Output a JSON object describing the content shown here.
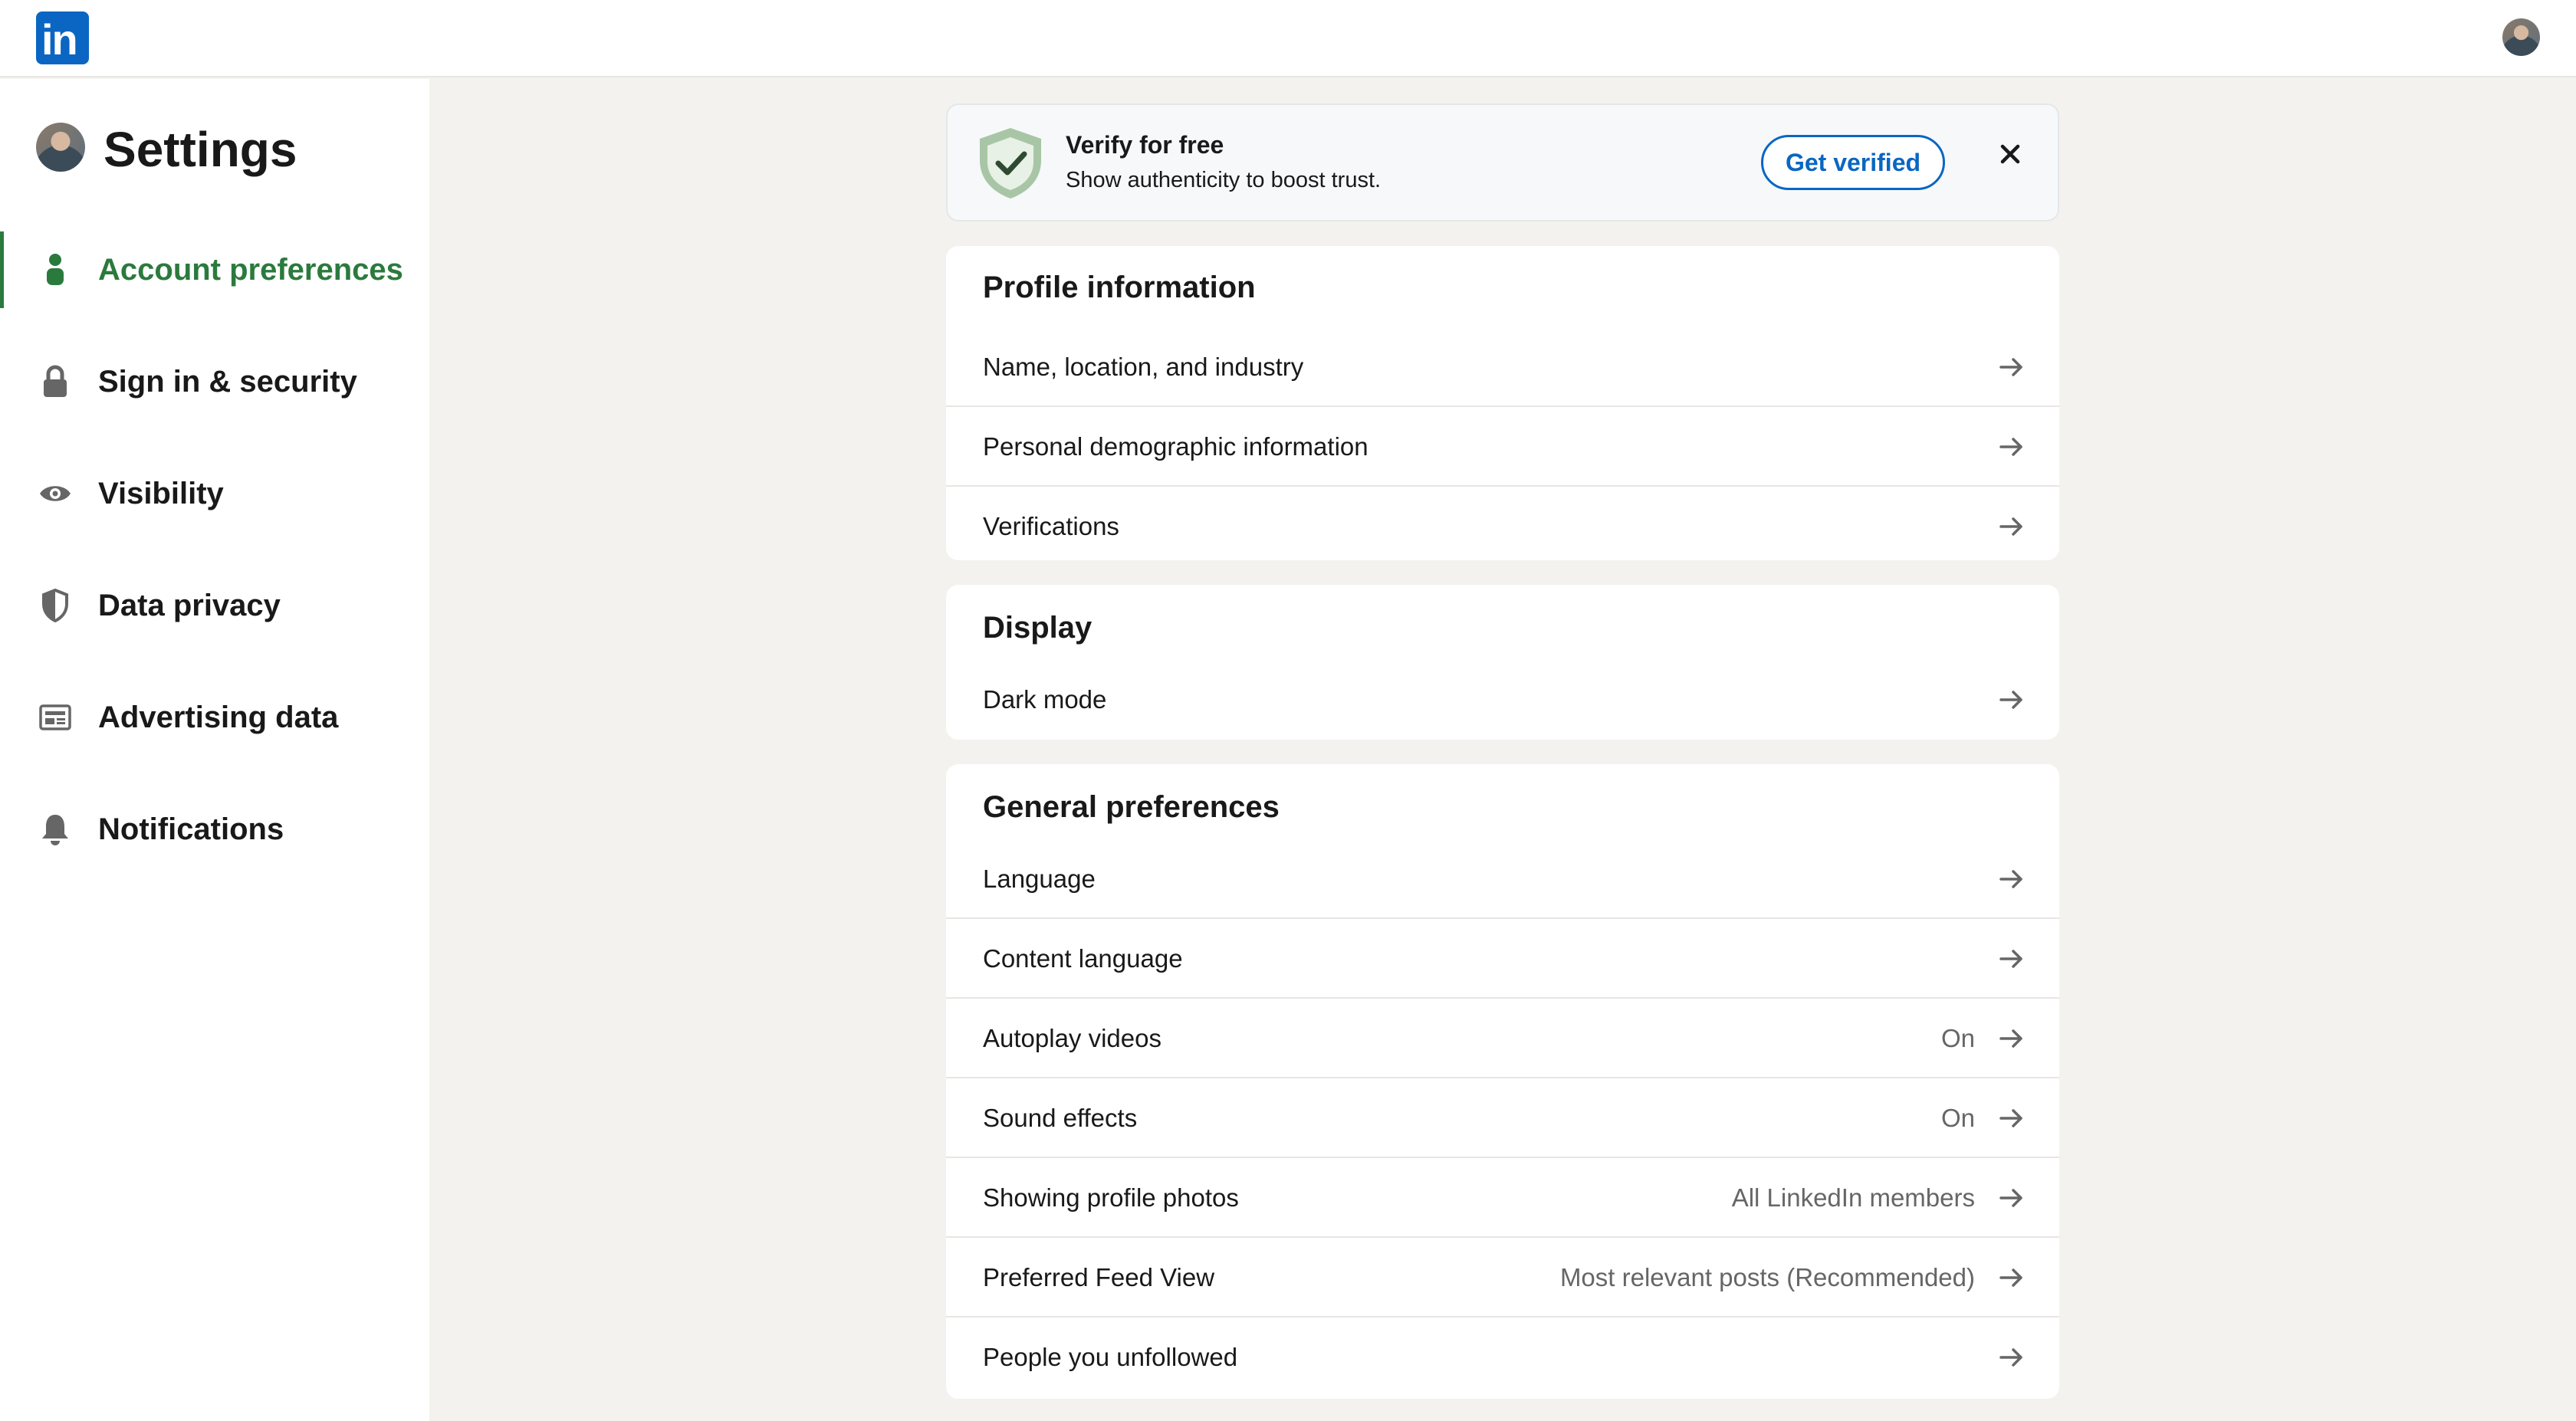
{
  "app": {
    "logo_text": "in"
  },
  "sidebar": {
    "title": "Settings",
    "items": [
      {
        "label": "Account preferences",
        "icon": "person-icon",
        "active": true
      },
      {
        "label": "Sign in & security",
        "icon": "lock-icon"
      },
      {
        "label": "Visibility",
        "icon": "eye-icon"
      },
      {
        "label": "Data privacy",
        "icon": "shield-icon"
      },
      {
        "label": "Advertising data",
        "icon": "ad-icon"
      },
      {
        "label": "Notifications",
        "icon": "bell-icon"
      }
    ]
  },
  "verify": {
    "title": "Verify for free",
    "subtitle": "Show authenticity to boost trust.",
    "button": "Get verified"
  },
  "profile_info": {
    "title": "Profile information",
    "rows": [
      {
        "label": "Name, location, and industry"
      },
      {
        "label": "Personal demographic information"
      },
      {
        "label": "Verifications"
      }
    ]
  },
  "display": {
    "title": "Display",
    "rows": [
      {
        "label": "Dark mode"
      }
    ]
  },
  "general": {
    "title": "General preferences",
    "rows": [
      {
        "label": "Language"
      },
      {
        "label": "Content language"
      },
      {
        "label": "Autoplay videos",
        "value": "On"
      },
      {
        "label": "Sound effects",
        "value": "On"
      },
      {
        "label": "Showing profile photos",
        "value": "All LinkedIn members"
      },
      {
        "label": "Preferred Feed View",
        "value": "Most relevant posts (Recommended)"
      },
      {
        "label": "People you unfollowed"
      }
    ]
  },
  "colors": {
    "accent_green": "#2b7a3d",
    "brand_blue": "#0a66c2",
    "background": "#f4f2ee"
  }
}
